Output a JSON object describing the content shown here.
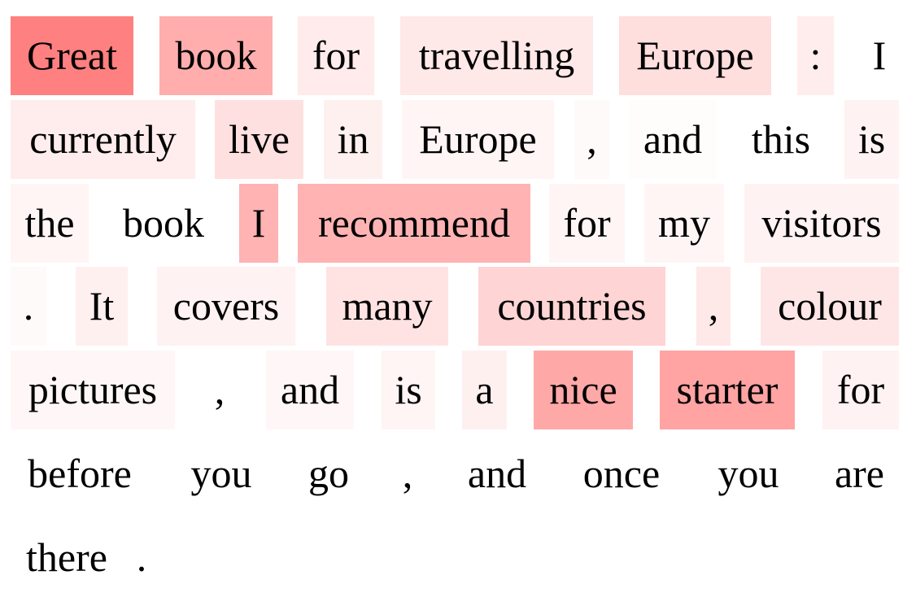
{
  "highlight_color": "#ff0000",
  "tokens": [
    {
      "text": "Great",
      "weight": 0.5
    },
    {
      "text": "book",
      "weight": 0.32
    },
    {
      "text": "for",
      "weight": 0.08
    },
    {
      "text": "travelling",
      "weight": 0.09
    },
    {
      "text": "Europe",
      "weight": 0.13
    },
    {
      "text": ":",
      "weight": 0.07
    },
    {
      "text": "I",
      "weight": 0.0
    },
    {
      "text": "currently",
      "weight": 0.07
    },
    {
      "text": "live",
      "weight": 0.12
    },
    {
      "text": "in",
      "weight": 0.06
    },
    {
      "text": "Europe",
      "weight": 0.04
    },
    {
      "text": ",",
      "weight": 0.02
    },
    {
      "text": "and",
      "weight": 0.01
    },
    {
      "text": "this",
      "weight": 0.0
    },
    {
      "text": "is",
      "weight": 0.05
    },
    {
      "text": "the",
      "weight": 0.04
    },
    {
      "text": "book",
      "weight": 0.0
    },
    {
      "text": "I",
      "weight": 0.3
    },
    {
      "text": "recommend",
      "weight": 0.3
    },
    {
      "text": "for",
      "weight": 0.04
    },
    {
      "text": "my",
      "weight": 0.04
    },
    {
      "text": "visitors",
      "weight": 0.05
    },
    {
      "text": ".",
      "weight": 0.02
    },
    {
      "text": "It",
      "weight": 0.06
    },
    {
      "text": "covers",
      "weight": 0.05
    },
    {
      "text": "many",
      "weight": 0.11
    },
    {
      "text": "countries",
      "weight": 0.17
    },
    {
      "text": ",",
      "weight": 0.09
    },
    {
      "text": "colour",
      "weight": 0.1
    },
    {
      "text": "pictures",
      "weight": 0.03
    },
    {
      "text": ",",
      "weight": 0.0
    },
    {
      "text": "and",
      "weight": 0.03
    },
    {
      "text": "is",
      "weight": 0.04
    },
    {
      "text": "a",
      "weight": 0.06
    },
    {
      "text": "nice",
      "weight": 0.34
    },
    {
      "text": "starter",
      "weight": 0.36
    },
    {
      "text": "for",
      "weight": 0.05
    },
    {
      "text": "before",
      "weight": 0.0
    },
    {
      "text": "you",
      "weight": 0.0
    },
    {
      "text": "go",
      "weight": 0.0
    },
    {
      "text": ",",
      "weight": 0.0
    },
    {
      "text": "and",
      "weight": 0.0
    },
    {
      "text": "once",
      "weight": 0.0
    },
    {
      "text": "you",
      "weight": 0.0
    },
    {
      "text": "are",
      "weight": 0.0
    },
    {
      "text": "there",
      "weight": 0.0
    },
    {
      "text": ".",
      "weight": 0.0
    }
  ]
}
